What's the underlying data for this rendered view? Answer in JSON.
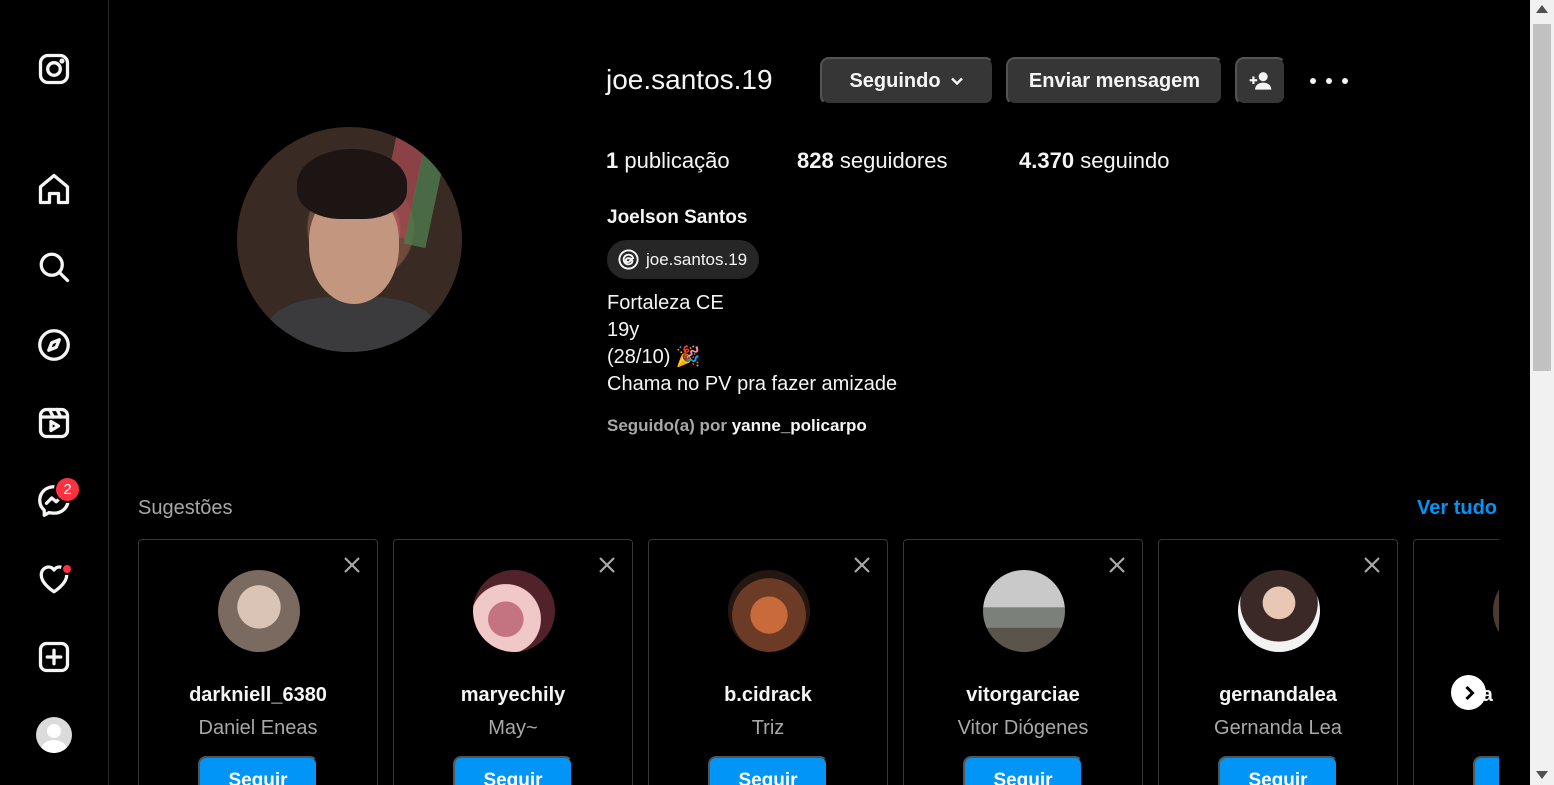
{
  "sidebar": {
    "items": [
      {
        "name": "instagram-logo-icon"
      },
      {
        "name": "home-icon"
      },
      {
        "name": "search-icon"
      },
      {
        "name": "explore-icon"
      },
      {
        "name": "reels-icon"
      },
      {
        "name": "messenger-icon"
      },
      {
        "name": "heart-icon"
      },
      {
        "name": "create-icon"
      },
      {
        "name": "profile-avatar"
      }
    ],
    "messages_badge": "2"
  },
  "profile": {
    "username": "joe.santos.19",
    "following_button": "Seguindo",
    "message_button": "Enviar mensagem",
    "stats": {
      "posts_count": "1",
      "posts_label": "publicação",
      "followers_count": "828",
      "followers_label": "seguidores",
      "following_count": "4.370",
      "following_label": "seguindo"
    },
    "full_name": "Joelson Santos",
    "threads_handle": "joe.santos.19",
    "bio": [
      "Fortaleza CE",
      "19y",
      "(28/10) 🎉",
      "Chama no PV pra fazer amizade"
    ],
    "followed_by_prefix": "Seguido(a) por",
    "followed_by_user": "yanne_policarpo"
  },
  "suggestions": {
    "title": "Sugestões",
    "see_all": "Ver tudo",
    "follow_label": "Seguir",
    "cards": [
      {
        "username": "darkniell_6380",
        "name": "Daniel Eneas"
      },
      {
        "username": "maryechily",
        "name": "May~"
      },
      {
        "username": "b.cidrack",
        "name": "Triz"
      },
      {
        "username": "vitorgarciae",
        "name": "Vitor Diógenes"
      },
      {
        "username": "gernandalea",
        "name": "Gernanda Lea"
      },
      {
        "username": "ra",
        "name": ""
      }
    ]
  },
  "colors": {
    "background": "#000000",
    "button": "#363636",
    "accent": "#0095f6",
    "badge": "#ff3040"
  }
}
